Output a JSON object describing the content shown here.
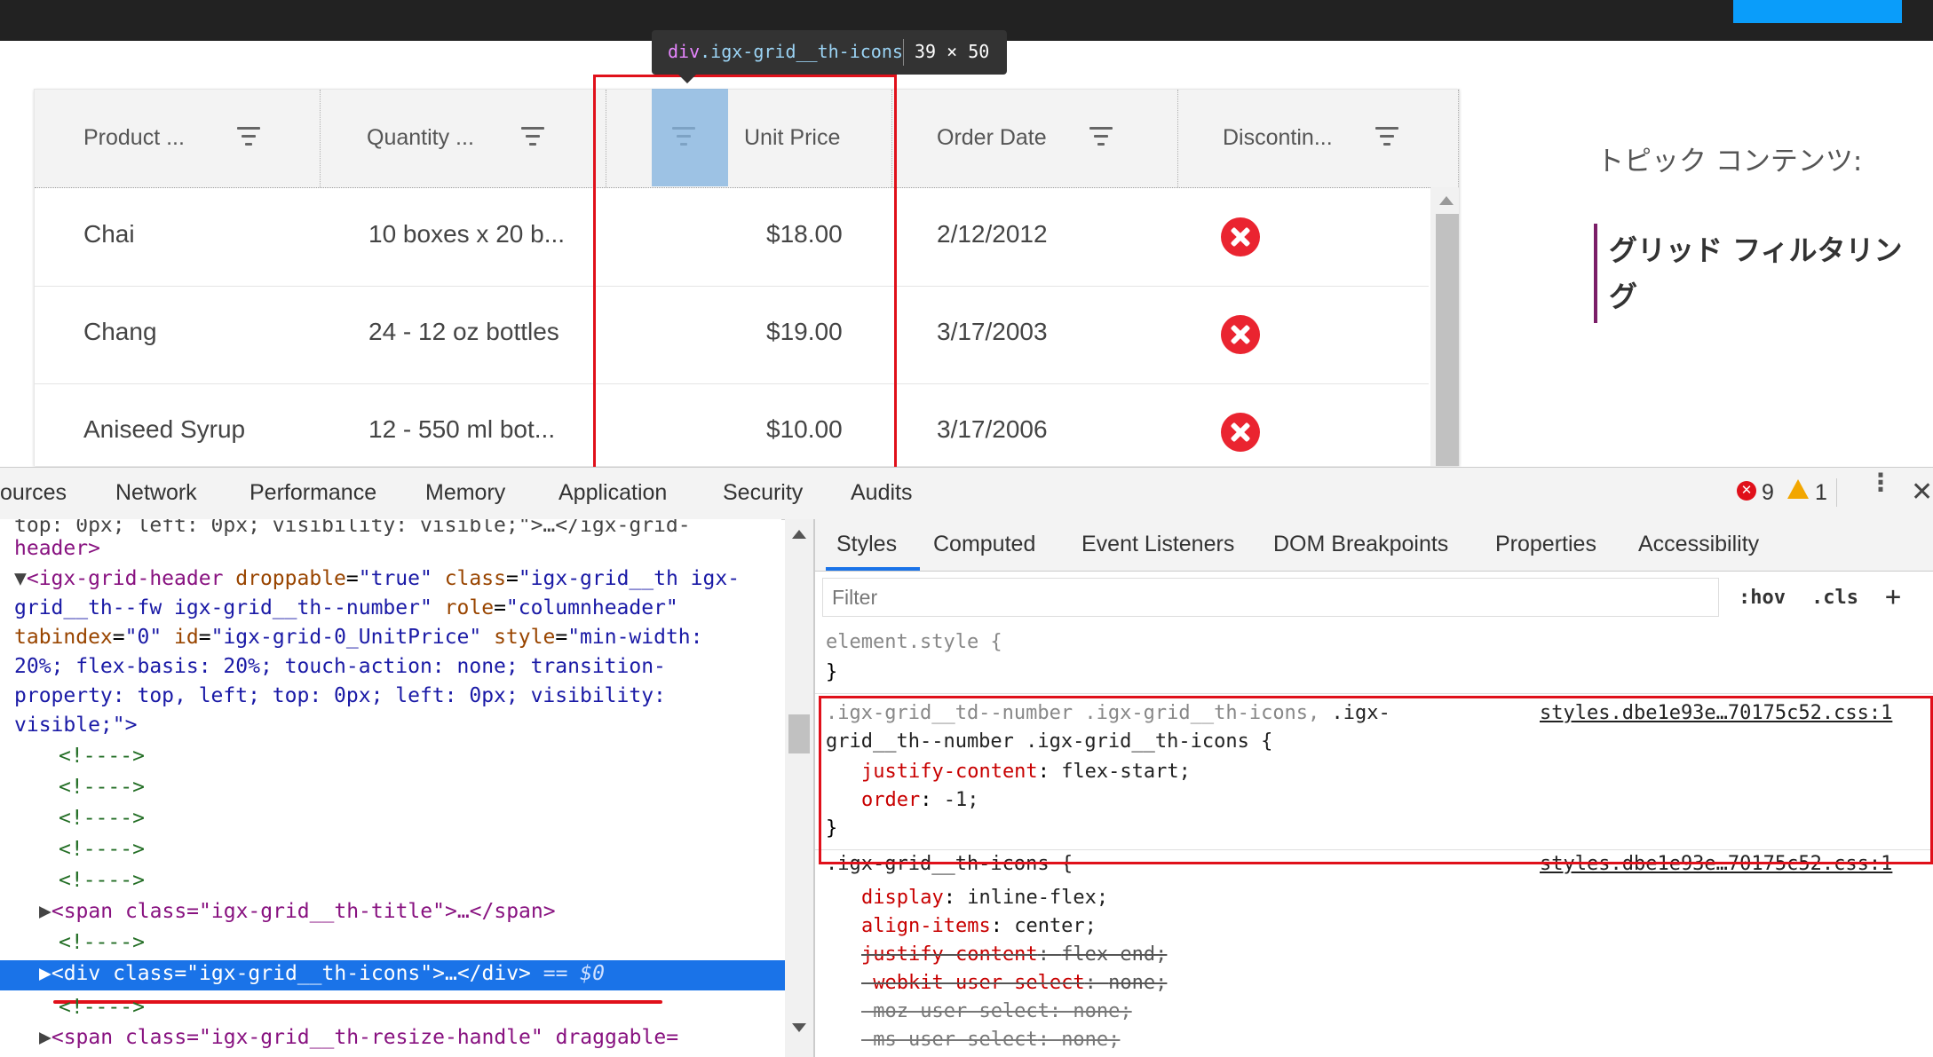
{
  "grid": {
    "columns": [
      "Product ...",
      "Quantity ...",
      "Unit Price",
      "Order Date",
      "Discontin..."
    ],
    "rows": [
      {
        "product": "Chai",
        "quantity": "10 boxes x 20 b...",
        "price": "$18.00",
        "date": "2/12/2012",
        "discontinued": true
      },
      {
        "product": "Chang",
        "quantity": "24 - 12 oz bottles",
        "price": "$19.00",
        "date": "3/17/2003",
        "discontinued": true
      },
      {
        "product": "Aniseed Syrup",
        "quantity": "12 - 550 ml bot...",
        "price": "$10.00",
        "date": "3/17/2006",
        "discontinued": true
      }
    ]
  },
  "tooltip": {
    "tag": "div",
    "cls": ".igx-grid__th-icons",
    "size": "39 × 50"
  },
  "toc": {
    "heading": "トピック コンテンツ:",
    "item": "グリッド フィルタリング"
  },
  "devtools": {
    "tabs": [
      "ources",
      "Network",
      "Performance",
      "Memory",
      "Application",
      "Security",
      "Audits"
    ],
    "errors": "9",
    "warnings": "1",
    "styles_tabs": [
      "Styles",
      "Computed",
      "Event Listeners",
      "DOM Breakpoints",
      "Properties",
      "Accessibility"
    ],
    "filter_placeholder": "Filter",
    "hov": ":hov",
    "cls": ".cls",
    "plus": "+",
    "dom": {
      "l0": "top: 0px; left: 0px; visibility: visible;\">…</igx-grid-",
      "l1": "header>",
      "l2_tag": "<igx-grid-header",
      "l2_a1": " droppable",
      "l2_v1": "\"true\"",
      "l2_a2": " class",
      "l2_v2": "\"igx-grid__th igx-",
      "l3": "grid__th--fw igx-grid__th--number\"",
      "l3_a": " role",
      "l3_v": "\"columnheader\"",
      "l4_a1": "tabindex",
      "l4_v1": "\"0\"",
      "l4_a2": " id",
      "l4_v2": "\"igx-grid-0_UnitPrice\"",
      "l4_a3": " style",
      "l4_v3": "\"min-width:",
      "l5": "20%; flex-basis: 20%; touch-action: none; transition-",
      "l6": "property: top, left; top: 0px; left: 0px; visibility:",
      "l7": "visible;\">",
      "comment": "<!---->",
      "span_title": "<span class=\"igx-grid__th-title\">…</span>",
      "div_icons": "<div class=\"igx-grid__th-icons\">…</div>",
      "eq": " == $0",
      "span_resize": "<span class=\"igx-grid__th-resize-handle\" draggable="
    },
    "styles": {
      "element_style": "element.style {",
      "close": "}",
      "rule1_sel_a": ".igx-grid__td--number .igx-grid__th-icons, ",
      "rule1_sel_b": ".igx-",
      "rule1_sel_c": "grid__th--number .igx-grid__th-icons {",
      "rule1_src": "styles.dbe1e93e…70175c52.css:1",
      "rule1_p1": "justify-content",
      "rule1_v1": "flex-start;",
      "rule1_p2": "order",
      "rule1_v2": "-1;",
      "rule2_sel": ".igx-grid__th-icons {",
      "rule2_src": "styles.dbe1e93e…70175c52.css:1",
      "rule2_p1": "display",
      "rule2_v1": "inline-flex;",
      "rule2_p2": "align-items",
      "rule2_v2": "center;",
      "rule2_p3": "justify-content",
      "rule2_v3": "flex-end;",
      "rule2_p4": "-webkit-user-select",
      "rule2_v4": "none;",
      "rule2_p5": "-moz-user-select",
      "rule2_v5": "none;",
      "rule2_p6": "-ms-user-select",
      "rule2_v6": "none;"
    }
  }
}
